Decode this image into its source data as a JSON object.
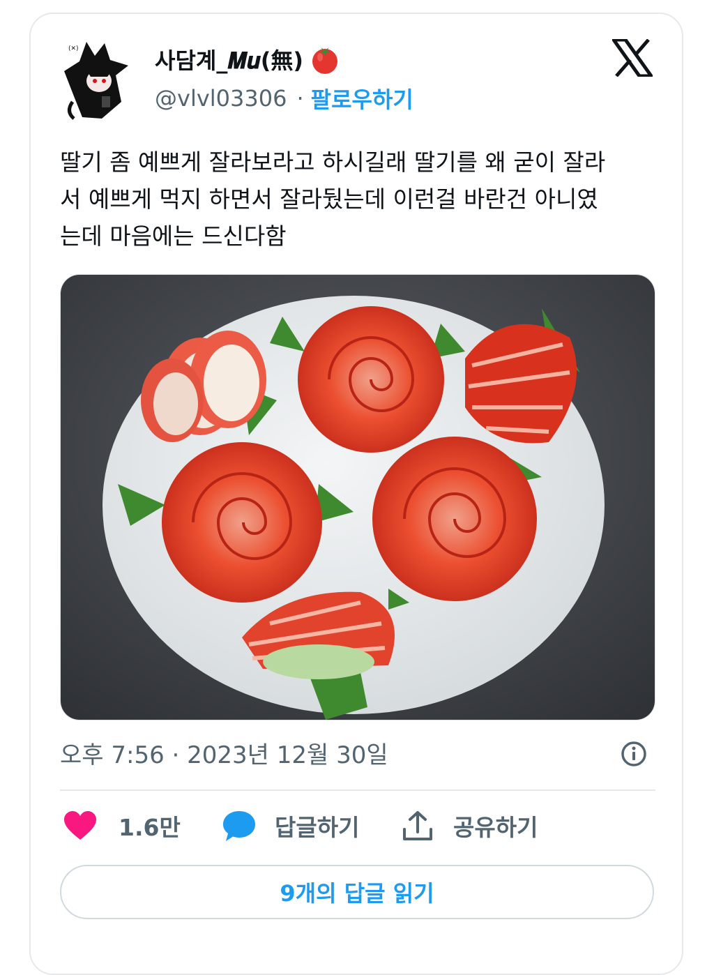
{
  "author": {
    "display_name": "사담계_𝑴𝒖(無)",
    "handle": "@vlvl03306",
    "separator": "·",
    "follow_label": "팔로우하기",
    "emoji_icon": "tomato-icon"
  },
  "tweet": {
    "text": "딸기 좀 예쁘게 잘라보라고 하시길래 딸기를 왜 굳이 잘라\n서 예쁘게 먹지 하면서 잘라뒀는데 이런걸 바란건 아니였\n는데 마음에는 드신다함",
    "timestamp": "오후 7:56 · 2023년 12월 30일"
  },
  "actions": {
    "like_count": "1.6만",
    "reply_label": "답글하기",
    "share_label": "공유하기"
  },
  "replies_button": "9개의 답글 읽기",
  "colors": {
    "accent": "#1d9bf0",
    "like": "#f91880",
    "muted": "#536471"
  }
}
